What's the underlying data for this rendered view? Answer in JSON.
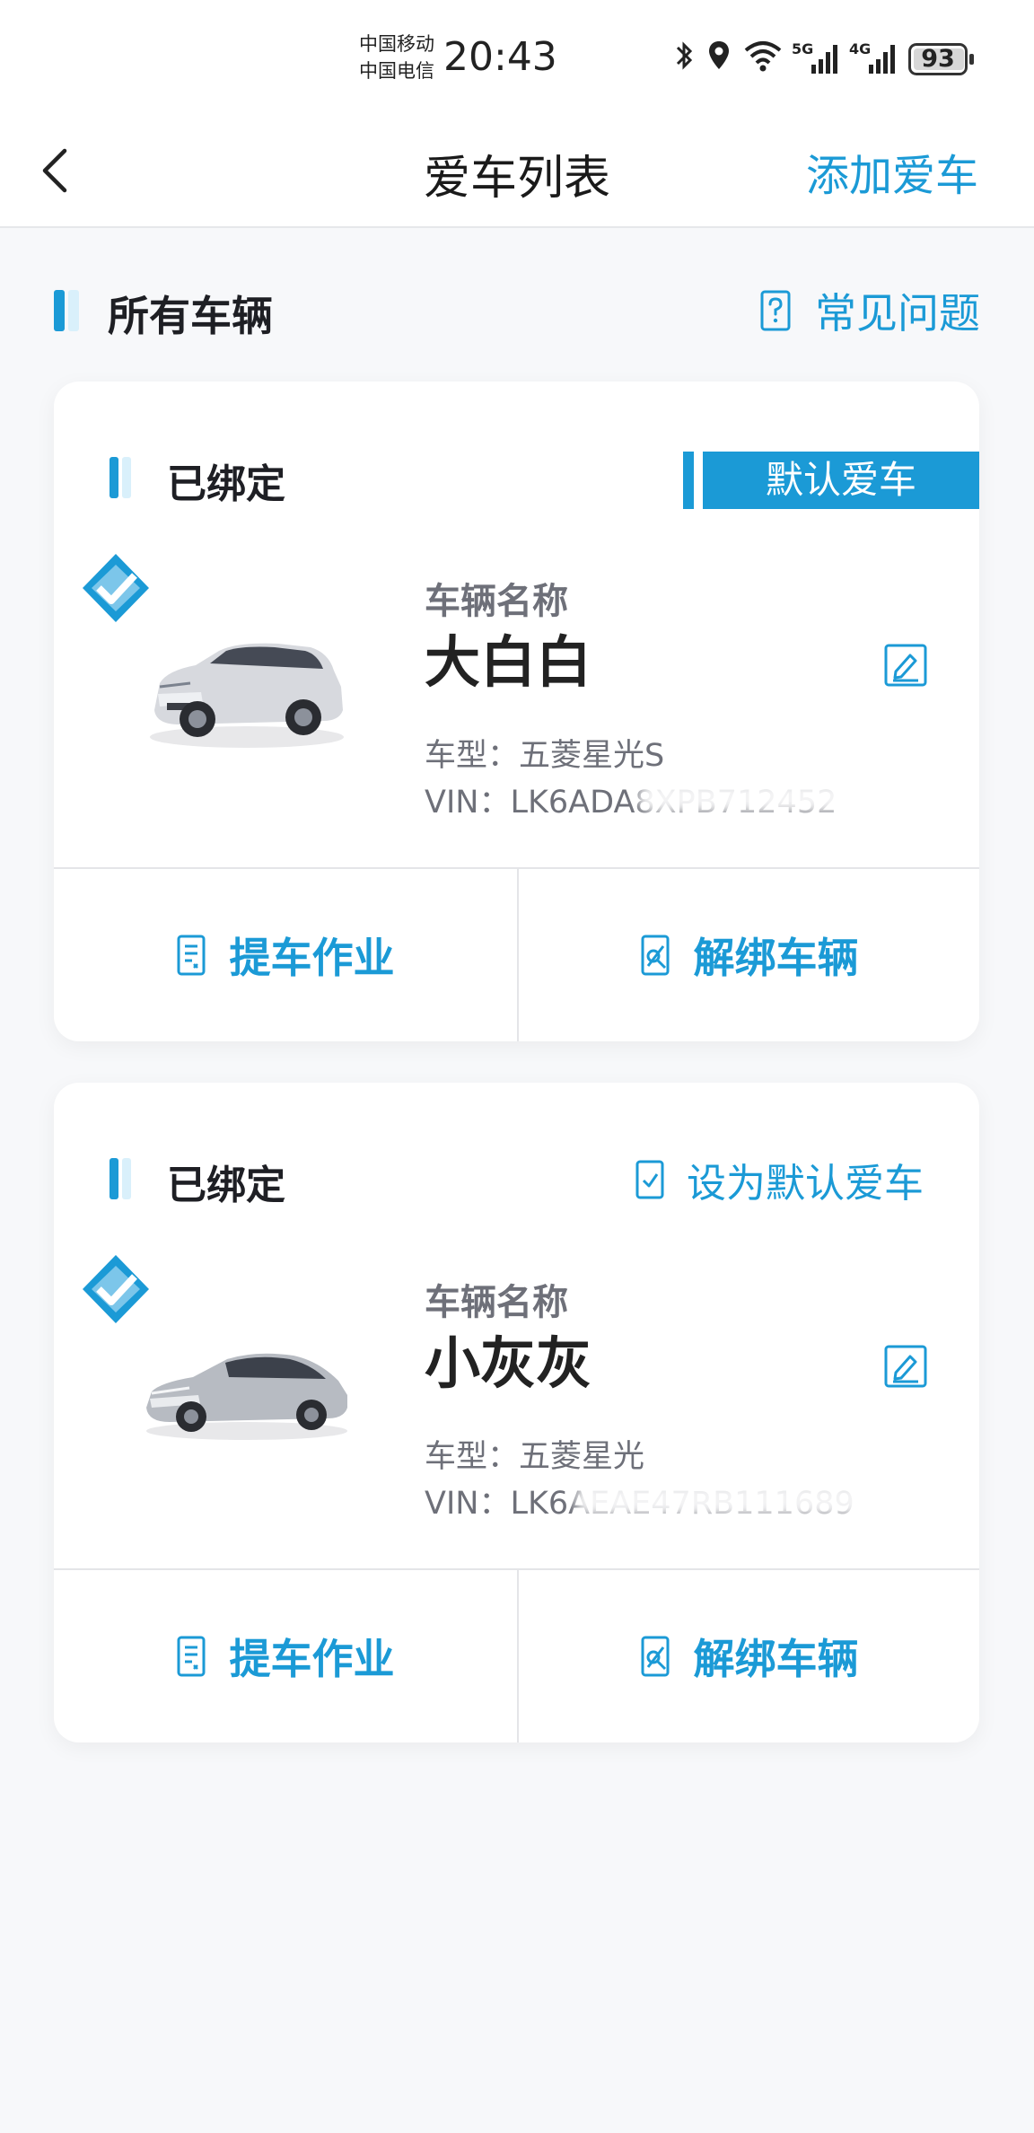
{
  "status_bar": {
    "carrier_1": "中国移动",
    "carrier_2": "中国电信",
    "time": "20:43",
    "signal_1": "5G",
    "signal_2": "4G",
    "battery": "93"
  },
  "nav": {
    "title": "爱车列表",
    "action": "添加爱车"
  },
  "section": {
    "title": "所有车辆",
    "faq": "常见问题"
  },
  "cards": [
    {
      "status": "已绑定",
      "default_tag": "默认爱车",
      "name_label": "车辆名称",
      "name": "大白白",
      "model": "车型：五菱星光S",
      "vin": "VIN：LK6ADA",
      "vin_tail": "8XPB712452",
      "actions": {
        "pickup": "提车作业",
        "unbind": "解绑车辆"
      }
    },
    {
      "status": "已绑定",
      "set_default": "设为默认爱车",
      "name_label": "车辆名称",
      "name": "小灰灰",
      "model": "车型：五菱星光",
      "vin": "VIN：LK6AEAE",
      "vin_tail": "47RB111689",
      "actions": {
        "pickup": "提车作业",
        "unbind": "解绑车辆"
      }
    }
  ],
  "colors": {
    "accent": "#1b9ad6",
    "background": "#f7f8fa"
  }
}
